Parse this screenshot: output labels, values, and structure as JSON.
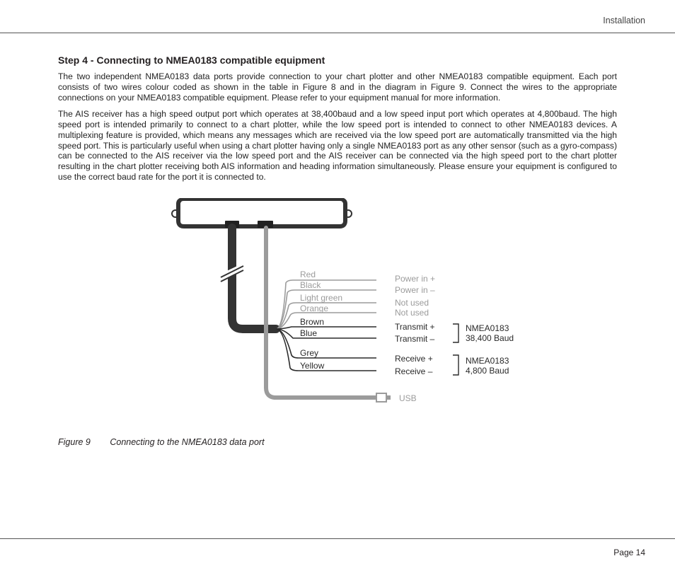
{
  "header": {
    "section": "Installation"
  },
  "footer": {
    "page": "Page 14"
  },
  "heading": "Step 4 - Connecting to NMEA0183 compatible equipment",
  "para1": "The two independent NMEA0183 data ports provide connection to your chart plotter and other NMEA0183 compatible equipment. Each port consists of two wires colour coded as shown in the table in Figure 8 and in the diagram in Figure 9. Connect the wires to the appropriate connections on your NMEA0183 compatible equipment. Please refer to your equipment manual for more information.",
  "para2": "The AIS receiver has a high speed output port which operates at 38,400baud and a low speed input port which operates at 4,800baud. The high speed port is intended primarily to connect to a chart plotter, while the low speed port is intended to connect to other NMEA0183 devices. A multiplexing feature is provided, which means any messages which are received via the low speed port are automatically transmitted via the high speed port. This is particularly useful when using a chart plotter having only a single NMEA0183 port as any other sensor (such as a gyro-compass) can be connected to the AIS receiver via the low speed port and the AIS receiver can be connected via the high speed port to the chart plotter resulting in the chart plotter receiving both AIS information and heading information simultaneously. Please ensure your equipment is configured to use the correct baud rate for the port it is connected to.",
  "figure": {
    "number": "Figure 9",
    "caption": "Connecting to the NMEA0183 data port"
  },
  "wires": {
    "red": {
      "color": "Red",
      "signal": "Power in +"
    },
    "black": {
      "color": "Black",
      "signal": "Power in –"
    },
    "lightgreen": {
      "color": "Light green",
      "signal": "Not used"
    },
    "orange": {
      "color": "Orange",
      "signal": "Not used"
    },
    "brown": {
      "color": "Brown",
      "signal": "Transmit +"
    },
    "blue": {
      "color": "Blue",
      "signal": "Transmit –"
    },
    "grey": {
      "color": "Grey",
      "signal": "Receive +"
    },
    "yellow": {
      "color": "Yellow",
      "signal": "Receive –"
    }
  },
  "usb_label": "USB",
  "group_hi": {
    "l1": "NMEA0183",
    "l2": "38,400 Baud"
  },
  "group_lo": {
    "l1": "NMEA0183",
    "l2": "4,800 Baud"
  },
  "colors": {
    "faded": "#9b9b9b",
    "dark": "#2a2a2a"
  }
}
